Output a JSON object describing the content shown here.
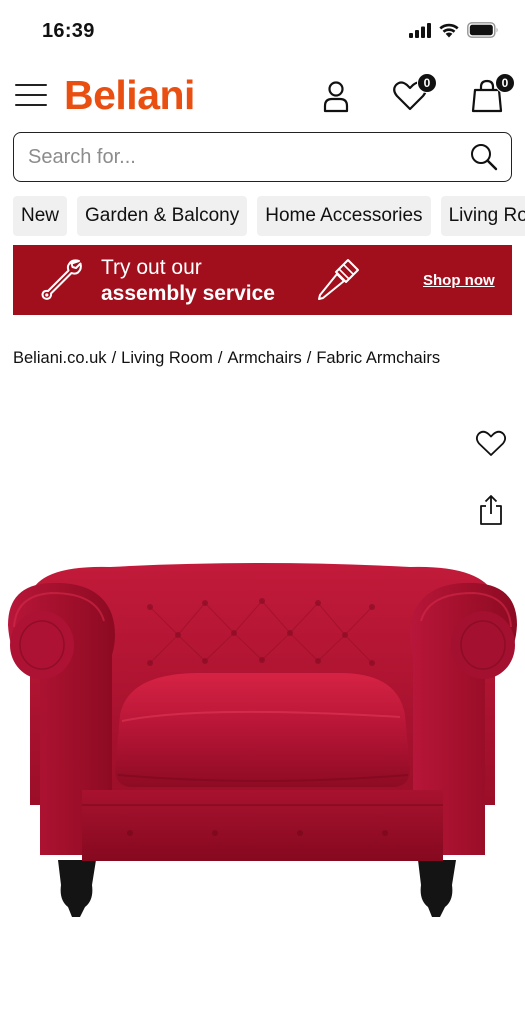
{
  "status": {
    "time": "16:39"
  },
  "header": {
    "logo": "Beliani",
    "wishlist_count": "0",
    "cart_count": "0"
  },
  "search": {
    "placeholder": "Search for..."
  },
  "categories": [
    "New",
    "Garden & Balcony",
    "Home Accessories",
    "Living Room"
  ],
  "banner": {
    "line1": "Try out our",
    "line2": "assembly service",
    "cta": "Shop now",
    "background_color": "#a10f1c"
  },
  "breadcrumb": [
    "Beliani.co.uk",
    "Living Room",
    "Armchairs",
    "Fabric Armchairs"
  ],
  "colors": {
    "brand": "#ea4f12",
    "banner": "#a10f1c",
    "product_fabric": "#b0122e"
  }
}
